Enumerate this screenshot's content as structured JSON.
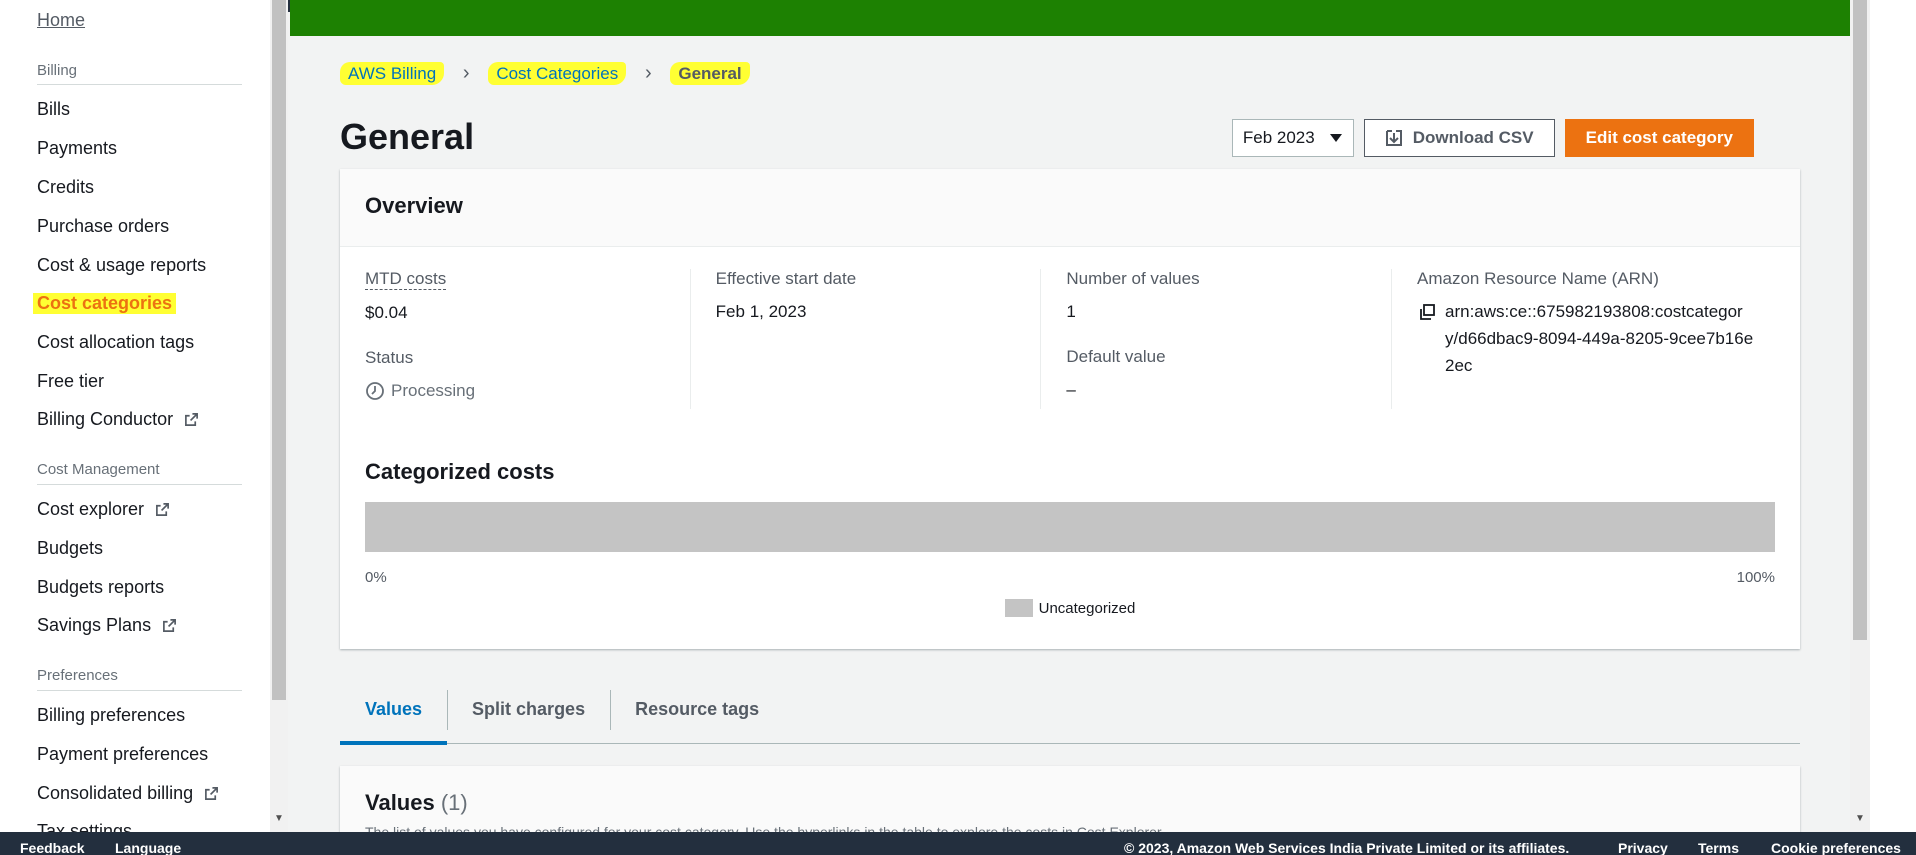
{
  "sidebar": {
    "home": "Home",
    "sections": {
      "billing": "Billing",
      "cost_management": "Cost Management",
      "preferences": "Preferences"
    },
    "billing_items": [
      "Bills",
      "Payments",
      "Credits",
      "Purchase orders",
      "Cost & usage reports",
      "Cost categories",
      "Cost allocation tags",
      "Free tier",
      "Billing Conductor"
    ],
    "cost_items": [
      "Cost explorer",
      "Budgets",
      "Budgets reports",
      "Savings Plans"
    ],
    "pref_items": [
      "Billing preferences",
      "Payment preferences",
      "Consolidated billing",
      "Tax settings"
    ]
  },
  "breadcrumb": {
    "root": "AWS Billing",
    "parent": "Cost Categories",
    "current": "General"
  },
  "page": {
    "title": "General",
    "month_select": "Feb 2023",
    "download_label": "Download CSV",
    "edit_label": "Edit cost category"
  },
  "overview": {
    "title": "Overview",
    "mtd_label": "MTD costs",
    "mtd_value": "$0.04",
    "status_label": "Status",
    "status_value": "Processing",
    "start_label": "Effective start date",
    "start_value": "Feb 1, 2023",
    "num_label": "Number of values",
    "num_value": "1",
    "default_label": "Default value",
    "default_value": "–",
    "arn_label": "Amazon Resource Name (ARN)",
    "arn_value": "arn:aws:ce::675982193808:costcategory/d66dbac9-8094-449a-8205-9cee7b16e2ec"
  },
  "categorized": {
    "title": "Categorized costs",
    "min_label": "0%",
    "max_label": "100%",
    "legend": "Uncategorized",
    "uncategorized_fraction": 1.0,
    "color": "#c4c4c4"
  },
  "tabs": [
    "Values",
    "Split charges",
    "Resource tags"
  ],
  "values_section": {
    "title": "Values",
    "count": "(1)",
    "description": "The list of values you have configured for your cost category. Use the hyperlinks in the table to explore the costs in Cost Explorer."
  },
  "footer": {
    "feedback": "Feedback",
    "language": "Language",
    "copyright": "© 2023, Amazon Web Services India Private Limited or its affiliates.",
    "privacy": "Privacy",
    "terms": "Terms",
    "cookies": "Cookie preferences"
  },
  "colors": {
    "accent": "#ec7211",
    "link": "#0073bb",
    "banner": "#1d8102",
    "highlight": "#ffff33"
  }
}
